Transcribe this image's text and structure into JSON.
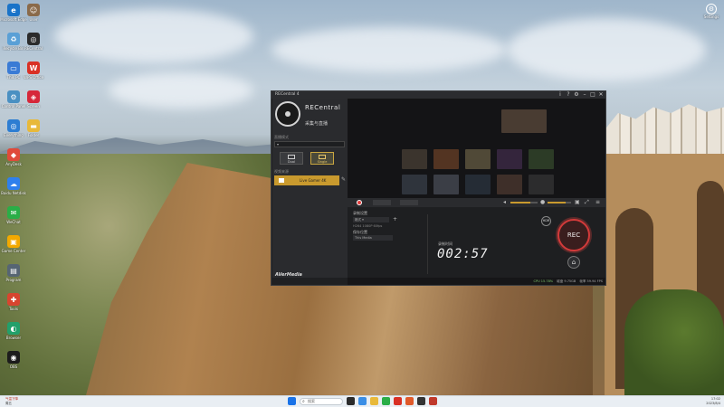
{
  "desktop": {
    "icons": [
      {
        "label": "Microsoft Edge",
        "color": "#1a73c8",
        "glyph": "e"
      },
      {
        "label": "Recycle Bin",
        "color": "#5aa0d6",
        "glyph": "♻"
      },
      {
        "label": "This PC",
        "color": "#3a7bd5",
        "glyph": "▭"
      },
      {
        "label": "Control Panel",
        "color": "#4a90c2",
        "glyph": "⚙"
      },
      {
        "label": "Everything",
        "color": "#2d7dd2",
        "glyph": "◎"
      },
      {
        "label": "AnyDesk",
        "color": "#e04a3a",
        "glyph": "◆"
      },
      {
        "label": "Baidu Netdisk",
        "color": "#2f80ed",
        "glyph": "☁"
      },
      {
        "label": "WeChat",
        "color": "#2aae47",
        "glyph": "✉"
      },
      {
        "label": "Game Center",
        "color": "#f2a900",
        "glyph": "▣"
      },
      {
        "label": "Program",
        "color": "#566573",
        "glyph": "▤"
      },
      {
        "label": "Tools",
        "color": "#d8452f",
        "glyph": "✚"
      },
      {
        "label": "Browser",
        "color": "#22a06b",
        "glyph": "◐"
      },
      {
        "label": "OBS",
        "color": "#1c1c1c",
        "glyph": "◉"
      }
    ],
    "icons_col2": [
      {
        "label": "User",
        "color": "#8a6a4a",
        "glyph": "☺"
      },
      {
        "label": "RECentral",
        "color": "#2b2b2b",
        "glyph": "◎"
      },
      {
        "label": "WPS Office",
        "color": "#d93025",
        "glyph": "W"
      },
      {
        "label": "Screen",
        "color": "#d6283a",
        "glyph": "◈"
      },
      {
        "label": "Folder",
        "color": "#e8b93a",
        "glyph": "▬"
      }
    ],
    "top_right_icon": {
      "label": "Settings",
      "glyph": "⚙"
    }
  },
  "window": {
    "title": "RECentral 4",
    "controls": {
      "info": "i",
      "help": "?",
      "settings": "⚙",
      "minimize": "–",
      "maximize": "□",
      "close": "✕"
    },
    "brand": "RECentral",
    "subtitle": "采集与直播",
    "sidebar": {
      "device_label": "直播模式",
      "modes": [
        {
          "label": "Dual",
          "active": false
        },
        {
          "label": "Single",
          "active": true
        }
      ],
      "source_section": "视频来源",
      "source_item": "Live Gamer 4K",
      "footer_brand": "AVerMedia"
    },
    "controls_panel": {
      "record_settings": "录制设置",
      "format_value": "格式",
      "format_sub": "H264 1080P 60fps",
      "save_path_label": "保存位置",
      "save_path_value": "This Media"
    },
    "recording": {
      "time_label": "录制时间",
      "time_value": "002:57",
      "hdr_label": "HDR",
      "rec_label": "REC"
    },
    "status": {
      "cpu": "CPU 15.78%",
      "disk": "磁盘 9.75GB",
      "fps": "帧率 59.94 FPS"
    }
  },
  "taskbar": {
    "weather_line1": "气温下降",
    "weather_line2": "周五",
    "search_placeholder": "搜索",
    "clock_time": "17:02",
    "clock_date": "2023/8/4"
  }
}
